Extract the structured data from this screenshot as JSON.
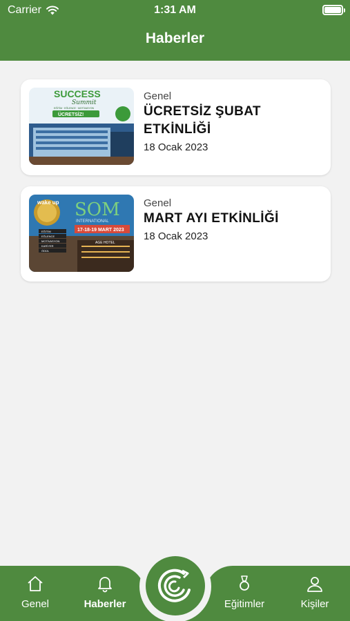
{
  "status": {
    "carrier": "Carrier",
    "time": "1:31 AM"
  },
  "header": {
    "title": "Haberler"
  },
  "news": [
    {
      "category": "Genel",
      "title_line1": "ÜCRETSİZ ŞUBAT",
      "title_line2": "ETKİNLİĞİ",
      "date": "18 Ocak 2023",
      "image": {
        "heading": "SUCCESS",
        "script": "Summit",
        "tagline": "EĞİTİM · EĞLENCE · MOTİVASYON",
        "ribbon": "ÜCRETSİZ!"
      }
    },
    {
      "category": "Genel",
      "title_line1": "MART AYI ETKİNLİĞİ",
      "title_line2": "",
      "date": "18 Ocak 2023",
      "image": {
        "badge": "wake up",
        "heading": "SOM",
        "sub": "INTERNATIONAL",
        "dates": "17-18-19 MART 2023",
        "hotel": "AGE HOTEL",
        "items": [
          "EĞİTİM",
          "EĞLENCE",
          "MOTİVASYON",
          "KARİYER",
          "ÖDÜL"
        ]
      }
    }
  ],
  "tabs": [
    {
      "label": "Genel",
      "icon": "home-icon",
      "active": false
    },
    {
      "label": "Haberler",
      "icon": "bell-icon",
      "active": true
    },
    {
      "label": "Eğitimler",
      "icon": "medal-icon",
      "active": false
    },
    {
      "label": "Kişiler",
      "icon": "person-icon",
      "active": false
    }
  ],
  "colors": {
    "primary": "#4f8a3f",
    "background": "#f2f2f2",
    "card": "#ffffff"
  }
}
